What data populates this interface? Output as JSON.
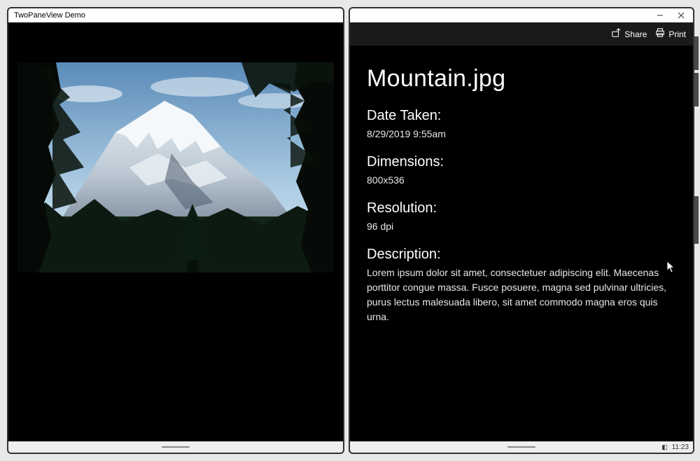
{
  "window": {
    "title": "TwoPaneView Demo"
  },
  "toolbar": {
    "share_label": "Share",
    "print_label": "Print"
  },
  "image": {
    "alt": "mountain-photo"
  },
  "details": {
    "file_name": "Mountain.jpg",
    "date_taken_label": "Date Taken:",
    "date_taken_value": "8/29/2019 9:55am",
    "dimensions_label": "Dimensions:",
    "dimensions_value": "800x536",
    "resolution_label": "Resolution:",
    "resolution_value": "96 dpi",
    "description_label": "Description:",
    "description_value": "Lorem ipsum dolor sit amet, consectetuer adipiscing elit. Maecenas porttitor congue massa. Fusce posuere, magna sed pulvinar ultricies, purus lectus malesuada libero, sit amet commodo magna eros quis urna."
  },
  "system": {
    "clock": "11:23"
  }
}
